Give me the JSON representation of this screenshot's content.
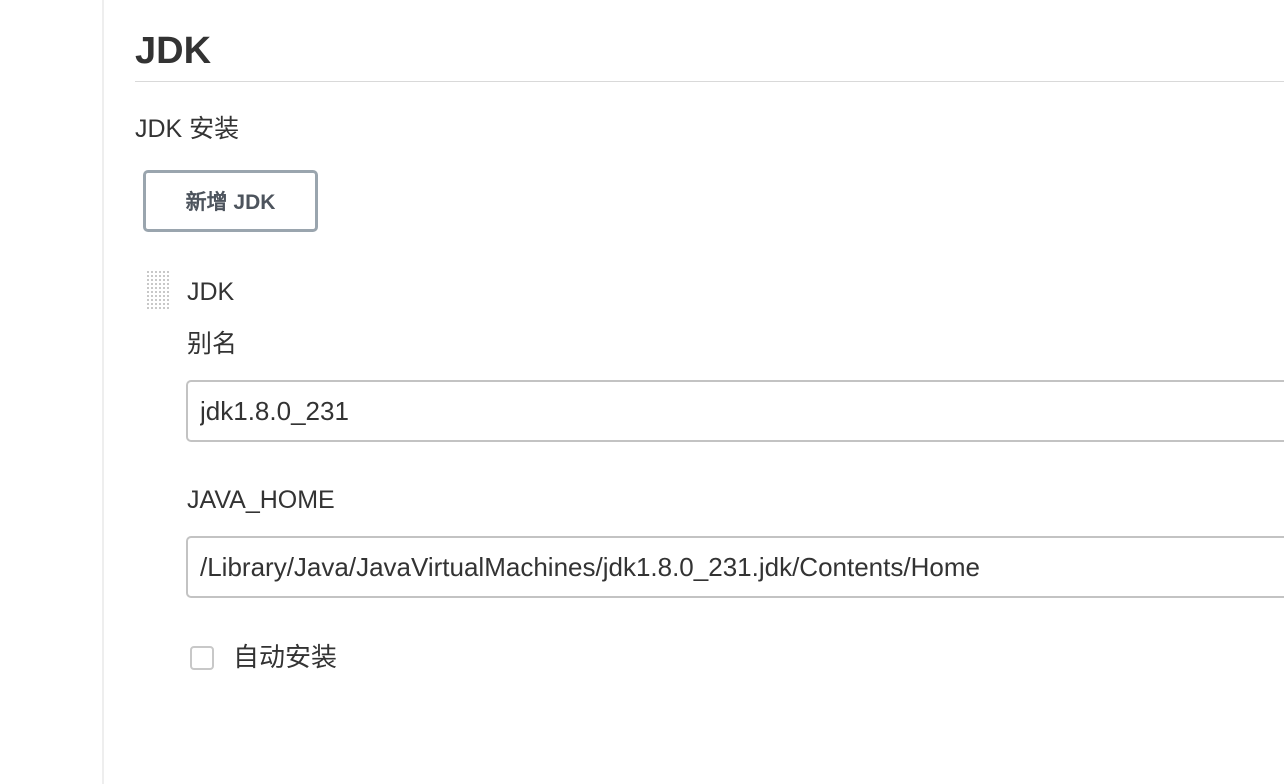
{
  "section": {
    "title": "JDK"
  },
  "jdk_installations": {
    "label": "JDK 安装",
    "add_button_label": "新增 JDK"
  },
  "jdk_item": {
    "title": "JDK",
    "alias_label": "别名",
    "alias_value": "jdk1.8.0_231",
    "java_home_label": "JAVA_HOME",
    "java_home_value": "/Library/Java/JavaVirtualMachines/jdk1.8.0_231.jdk/Contents/Home",
    "auto_install_label": "自动安装",
    "auto_install_checked": false,
    "drag_handle_icon": "drag-handle-icon"
  }
}
